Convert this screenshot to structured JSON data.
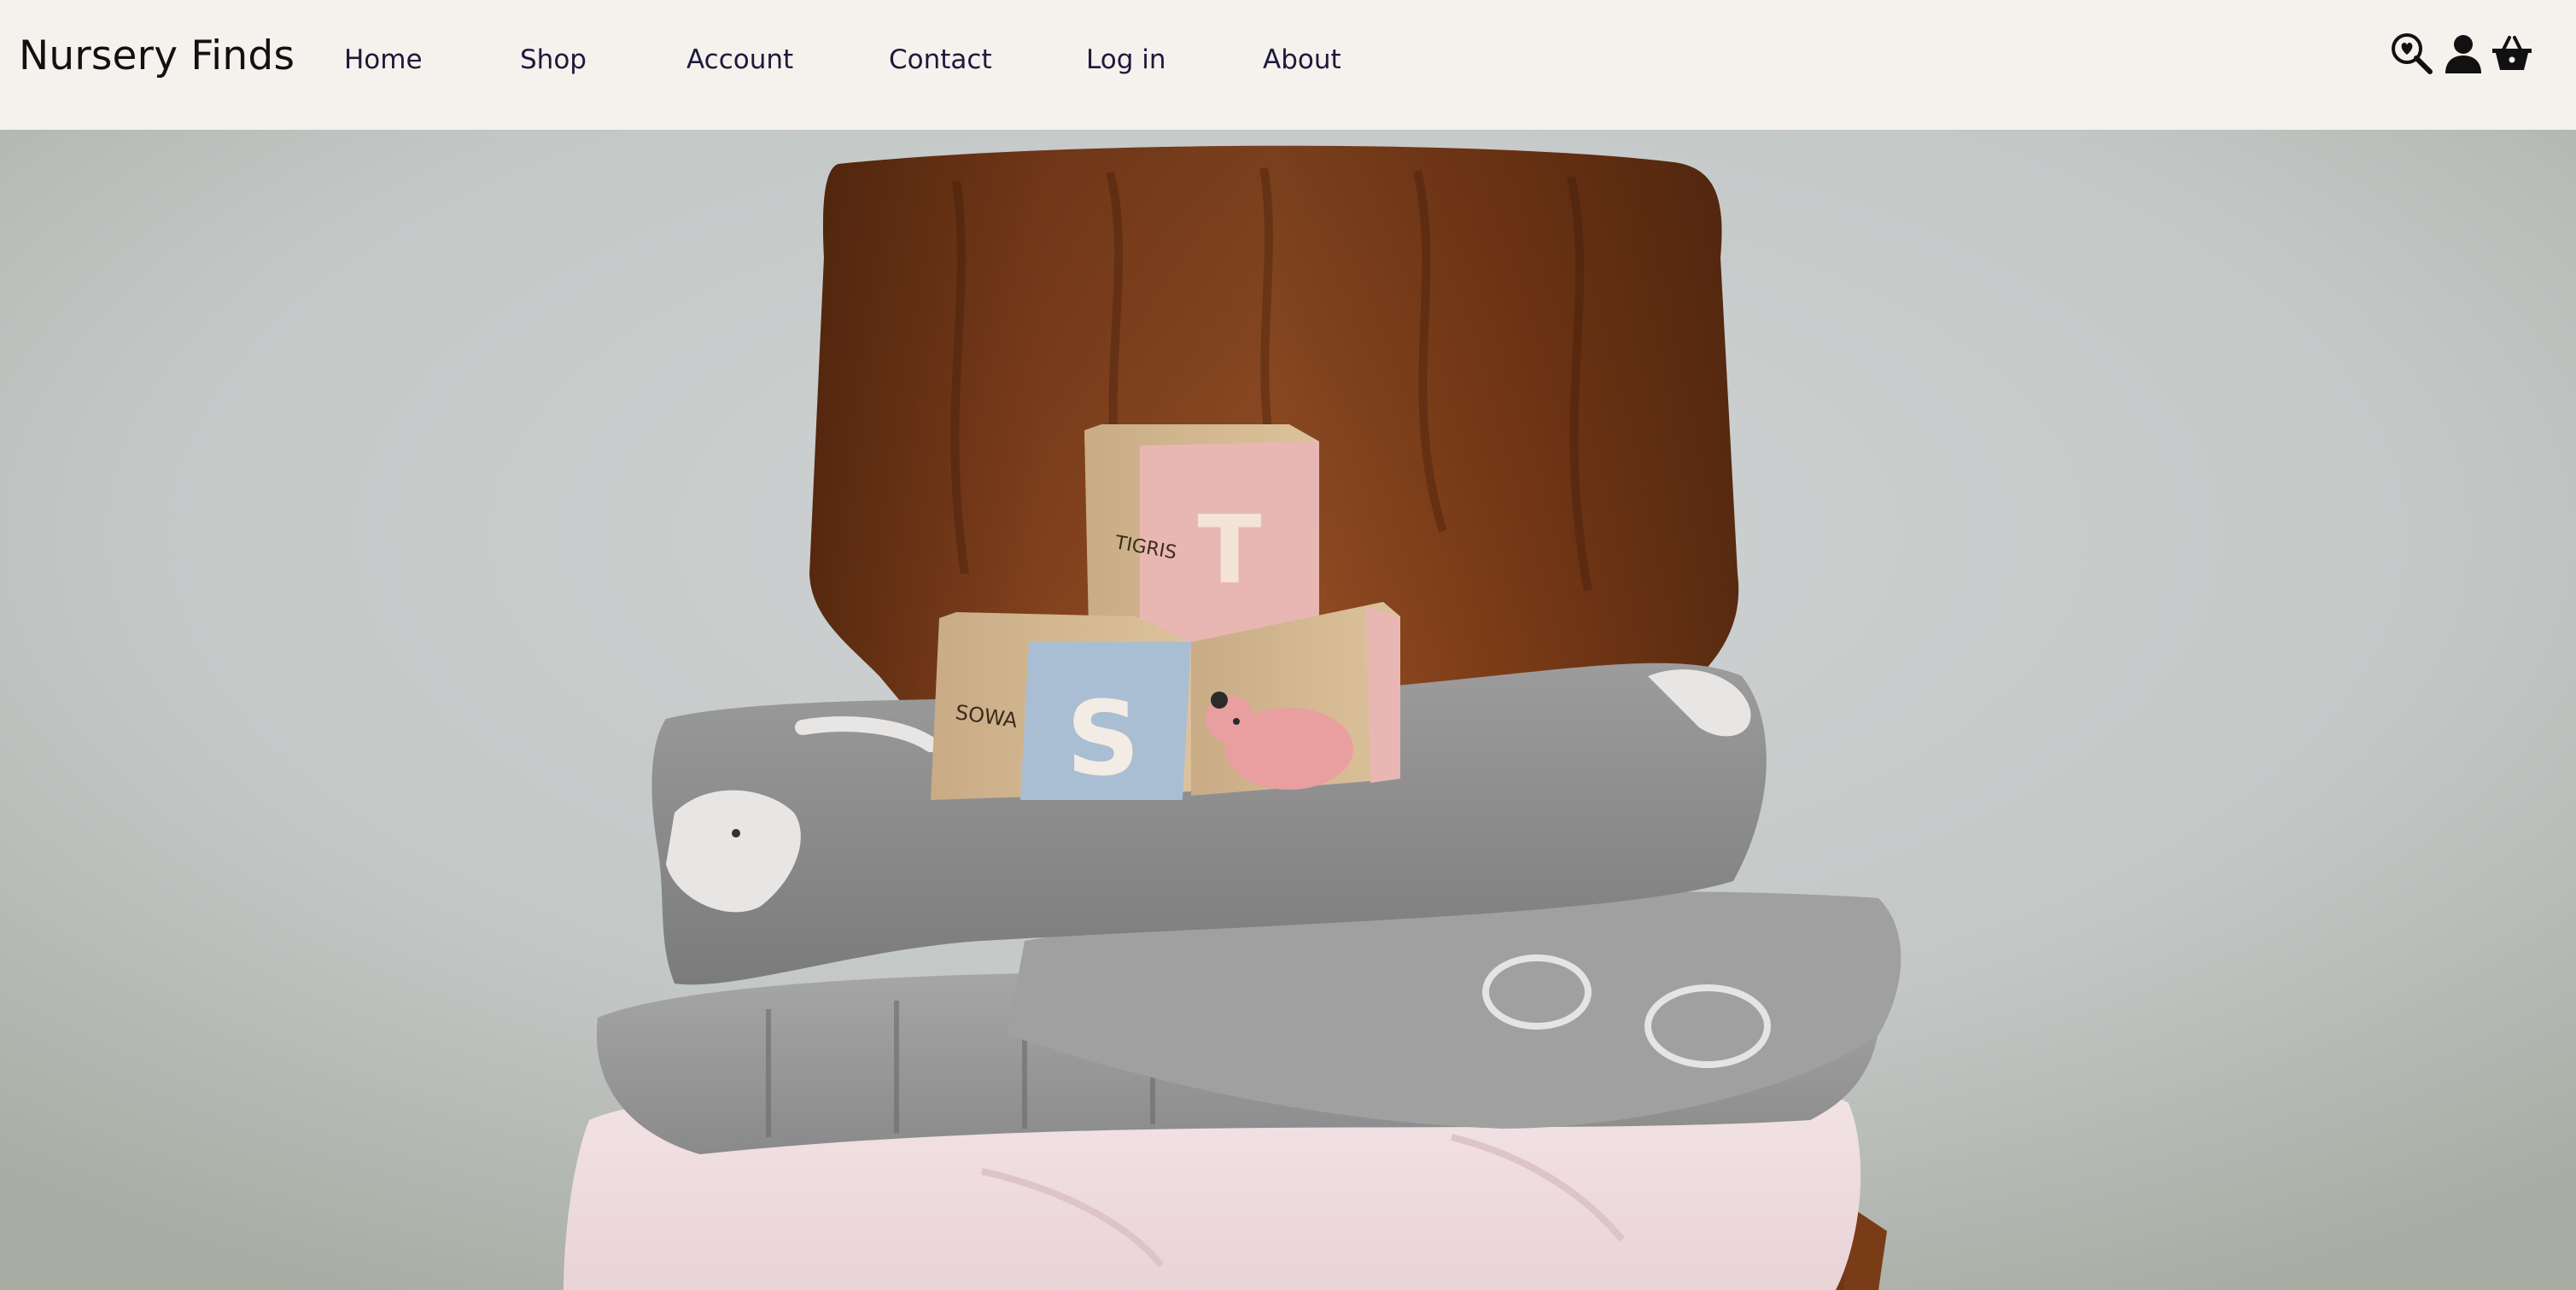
{
  "header": {
    "brand": "Nursery Finds",
    "nav": {
      "home": "Home",
      "shop": "Shop",
      "account": "Account",
      "contact": "Contact",
      "login": "Log in",
      "about": "About"
    },
    "icons": [
      "search-heart-icon",
      "user-icon",
      "basket-icon"
    ]
  },
  "hero": {
    "blocks": {
      "top_letter": "T",
      "left_letter": "S",
      "top_side_text": "TIGRIS",
      "left_side_text": "SOWA"
    }
  },
  "colors": {
    "header_bg": "#f5f1ed",
    "nav_text": "#1c1a3a",
    "wall": "#c6cbcb",
    "chair_wood": "#7a3b17",
    "block_pink": "#e8b7b3",
    "block_blue": "#a9bed3",
    "blanket_gray": "#8e8e8f",
    "blanket_pink": "#f2e2e4"
  }
}
